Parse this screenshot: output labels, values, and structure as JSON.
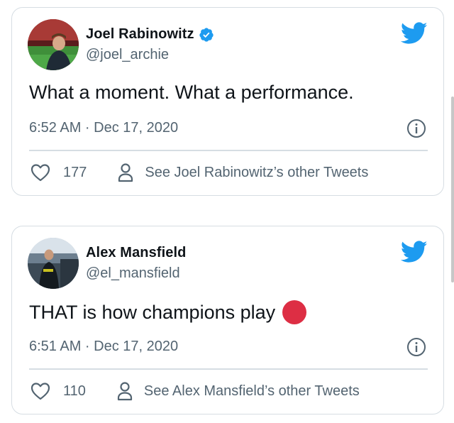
{
  "tweets": [
    {
      "display_name": "Joel Rabinowitz",
      "verified": true,
      "handle": "@joel_archie",
      "text": "What a moment. What a performance.",
      "has_emoji": false,
      "timestamp": "6:52 AM · Dec 17, 2020",
      "like_count": "177",
      "profile_link": "See Joel Rabinowitz’s other Tweets"
    },
    {
      "display_name": "Alex Mansfield",
      "verified": false,
      "handle": "@el_mansfield",
      "text": "THAT is how champions play",
      "has_emoji": true,
      "emoji": "red-circle",
      "timestamp": "6:51 AM · Dec 17, 2020",
      "like_count": "110",
      "profile_link": "See Alex Mansfield’s other Tweets"
    }
  ],
  "colors": {
    "twitter_blue": "#1d9bf0",
    "text_primary": "#0f1419",
    "text_secondary": "#536471",
    "border": "#d6dde3",
    "emoji_red": "#dd2e44"
  },
  "icons": [
    "verified-badge-icon",
    "twitter-bird-icon",
    "info-icon",
    "heart-icon",
    "person-icon"
  ]
}
